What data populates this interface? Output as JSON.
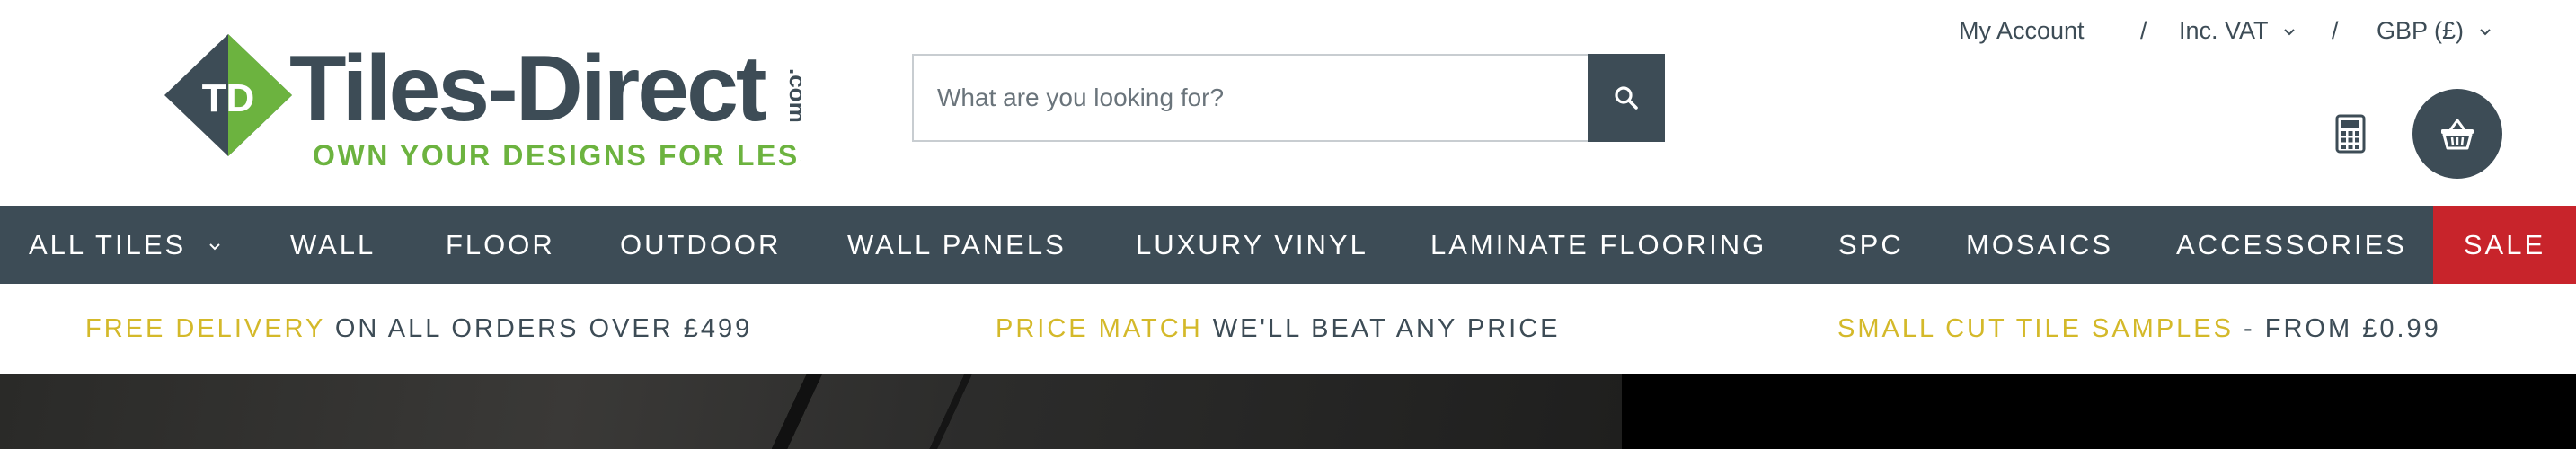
{
  "brand": {
    "logo_text": "Tiles-Direct",
    "logo_suffix": ".com",
    "logo_initials": "TD",
    "tagline": "OWN YOUR DESIGNS FOR LESS",
    "colors": {
      "dark": "#3d4c56",
      "green": "#6cb33f",
      "gold": "#d4b92a",
      "sale_red": "#c8242b"
    }
  },
  "search": {
    "placeholder": "What are you looking for?",
    "value": "",
    "button_icon": "search-icon"
  },
  "account_nav": {
    "my_account": "My Account",
    "separator": "/",
    "vat": "Inc. VAT",
    "currency": "GBP (£)"
  },
  "header_icons": {
    "calculator": "calculator-icon",
    "basket": "basket-icon"
  },
  "main_nav": {
    "items": [
      {
        "label": "ALL TILES"
      },
      {
        "label": "WALL"
      },
      {
        "label": "FLOOR"
      },
      {
        "label": "OUTDOOR"
      },
      {
        "label": "WALL PANELS"
      },
      {
        "label": "LUXURY VINYL"
      },
      {
        "label": "LAMINATE FLOORING"
      },
      {
        "label": "SPC"
      },
      {
        "label": "MOSAICS"
      },
      {
        "label": "ACCESSORIES"
      }
    ],
    "sale": "SALE"
  },
  "promos": [
    {
      "highlight": "FREE DELIVERY",
      "text": " ON ALL ORDERS OVER £499"
    },
    {
      "highlight": "PRICE MATCH",
      "text": " WE'LL BEAT ANY PRICE"
    },
    {
      "highlight": "SMALL CUT TILE SAMPLES",
      "text": " - FROM £0.99"
    }
  ]
}
